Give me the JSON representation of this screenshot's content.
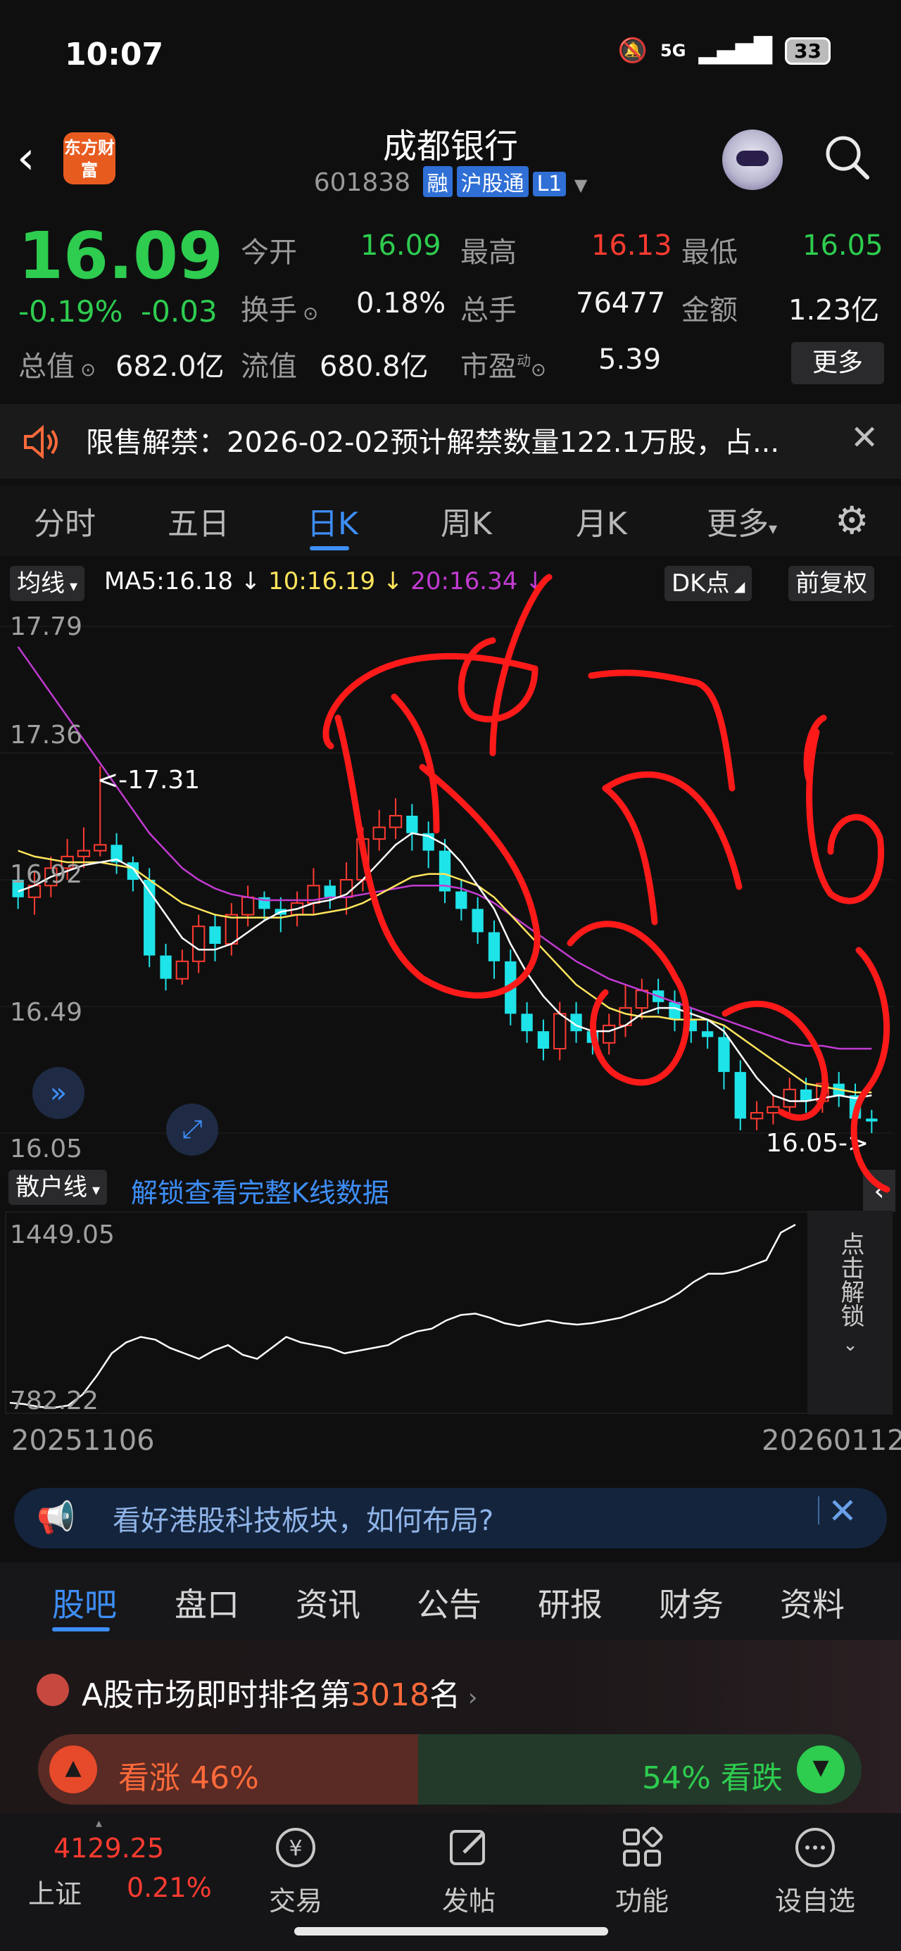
{
  "status_bar": {
    "time": "10:07",
    "network": "5G",
    "battery": "33"
  },
  "header": {
    "logo_text": "东方财富",
    "stock_name": "成都银行",
    "stock_code": "601838",
    "tags": [
      "融",
      "沪股通",
      "L1"
    ]
  },
  "quote": {
    "price": "16.09",
    "change_pct": "-0.19%",
    "change_abs": "-0.03",
    "fields": [
      {
        "label": "今开",
        "value": "16.09",
        "color": "#2ecc4f"
      },
      {
        "label": "最高",
        "value": "16.13",
        "color": "#ff3b30"
      },
      {
        "label": "最低",
        "value": "16.05",
        "color": "#2ecc4f"
      },
      {
        "label": "换手",
        "value": "0.18%",
        "color": "#f2f2f2"
      },
      {
        "label": "总手",
        "value": "76477",
        "color": "#f2f2f2"
      },
      {
        "label": "金额",
        "value": "1.23亿",
        "color": "#f2f2f2"
      },
      {
        "label": "总值",
        "value": "682.0亿",
        "color": "#f2f2f2"
      },
      {
        "label": "流值",
        "value": "680.8亿",
        "color": "#f2f2f2"
      },
      {
        "label": "市盈",
        "value": "5.39",
        "color": "#f2f2f2"
      }
    ],
    "more_label": "更多",
    "pe_superscript": "动"
  },
  "notice": {
    "text": "限售解禁：2026-02-02预计解禁数量122.1万股，占..."
  },
  "period_tabs": [
    "分时",
    "五日",
    "日K",
    "周K",
    "月K",
    "更多"
  ],
  "active_period": "日K",
  "chart_header": {
    "indicator": "均线",
    "ma5": "MA5:16.18 ↓",
    "ma10": "10:16.19 ↓",
    "ma20": "20:16.34 ↓",
    "dk_label": "DK点",
    "adjust_label": "前复权"
  },
  "chart_data": {
    "type": "candlestick",
    "y_ticks": [
      "17.79",
      "17.36",
      "16.92",
      "16.49",
      "16.05"
    ],
    "ylim": [
      16.05,
      17.79
    ],
    "high_annotation": "<-17.31",
    "low_annotation": "16.05->",
    "candles": [
      [
        16.92,
        16.86,
        16.97,
        16.82
      ],
      [
        16.86,
        16.9,
        16.95,
        16.8
      ],
      [
        16.9,
        16.96,
        17.0,
        16.86
      ],
      [
        16.96,
        17.0,
        17.06,
        16.92
      ],
      [
        17.0,
        17.02,
        17.1,
        16.96
      ],
      [
        17.02,
        17.04,
        17.31,
        17.0
      ],
      [
        17.04,
        16.98,
        17.08,
        16.94
      ],
      [
        16.98,
        16.92,
        17.0,
        16.88
      ],
      [
        16.92,
        16.66,
        16.96,
        16.62
      ],
      [
        16.66,
        16.58,
        16.7,
        16.54
      ],
      [
        16.58,
        16.64,
        16.68,
        16.56
      ],
      [
        16.64,
        16.76,
        16.8,
        16.6
      ],
      [
        16.76,
        16.7,
        16.8,
        16.64
      ],
      [
        16.7,
        16.8,
        16.84,
        16.66
      ],
      [
        16.8,
        16.86,
        16.9,
        16.76
      ],
      [
        16.86,
        16.82,
        16.88,
        16.78
      ],
      [
        16.82,
        16.8,
        16.86,
        16.74
      ],
      [
        16.8,
        16.84,
        16.88,
        16.76
      ],
      [
        16.84,
        16.9,
        16.96,
        16.8
      ],
      [
        16.9,
        16.86,
        16.92,
        16.82
      ],
      [
        16.86,
        16.92,
        16.98,
        16.8
      ],
      [
        16.92,
        17.06,
        17.1,
        16.88
      ],
      [
        17.06,
        17.1,
        17.16,
        17.02
      ],
      [
        17.1,
        17.14,
        17.2,
        17.06
      ],
      [
        17.14,
        17.08,
        17.18,
        17.02
      ],
      [
        17.08,
        17.02,
        17.12,
        16.96
      ],
      [
        17.02,
        16.88,
        17.06,
        16.84
      ],
      [
        16.88,
        16.82,
        16.92,
        16.78
      ],
      [
        16.82,
        16.74,
        16.86,
        16.7
      ],
      [
        16.74,
        16.64,
        16.78,
        16.58
      ],
      [
        16.64,
        16.46,
        16.68,
        16.42
      ],
      [
        16.46,
        16.4,
        16.5,
        16.36
      ],
      [
        16.4,
        16.34,
        16.44,
        16.3
      ],
      [
        16.34,
        16.46,
        16.5,
        16.3
      ],
      [
        16.46,
        16.4,
        16.5,
        16.36
      ],
      [
        16.4,
        16.36,
        16.44,
        16.32
      ],
      [
        16.36,
        16.42,
        16.46,
        16.32
      ],
      [
        16.42,
        16.48,
        16.56,
        16.38
      ],
      [
        16.48,
        16.54,
        16.58,
        16.44
      ],
      [
        16.54,
        16.5,
        16.58,
        16.46
      ],
      [
        16.5,
        16.44,
        16.54,
        16.4
      ],
      [
        16.44,
        16.4,
        16.48,
        16.36
      ],
      [
        16.4,
        16.38,
        16.44,
        16.34
      ],
      [
        16.38,
        16.26,
        16.42,
        16.2
      ],
      [
        16.26,
        16.1,
        16.3,
        16.06
      ],
      [
        16.1,
        16.12,
        16.16,
        16.06
      ],
      [
        16.12,
        16.14,
        16.18,
        16.08
      ],
      [
        16.14,
        16.2,
        16.24,
        16.1
      ],
      [
        16.2,
        16.16,
        16.24,
        16.12
      ],
      [
        16.16,
        16.22,
        16.26,
        16.12
      ],
      [
        16.22,
        16.18,
        16.26,
        16.14
      ],
      [
        16.18,
        16.1,
        16.22,
        16.06
      ],
      [
        16.1,
        16.09,
        16.13,
        16.05
      ]
    ],
    "candle_order": [
      "open",
      "close",
      "high",
      "low"
    ],
    "ma5": [
      16.88,
      16.9,
      16.93,
      16.95,
      16.97,
      16.98,
      16.99,
      16.96,
      16.88,
      16.8,
      16.72,
      16.68,
      16.68,
      16.7,
      16.74,
      16.78,
      16.81,
      16.82,
      16.84,
      16.85,
      16.87,
      16.92,
      16.98,
      17.04,
      17.08,
      17.07,
      17.04,
      16.98,
      16.9,
      16.82,
      16.7,
      16.6,
      16.52,
      16.46,
      16.42,
      16.4,
      16.4,
      16.42,
      16.46,
      16.48,
      16.48,
      16.46,
      16.44,
      16.4,
      16.32,
      16.24,
      16.18,
      16.16,
      16.16,
      16.17,
      16.18,
      16.17,
      16.18
    ],
    "ma10": [
      17.02,
      17.0,
      16.99,
      16.98,
      16.98,
      16.98,
      16.97,
      16.96,
      16.92,
      16.88,
      16.84,
      16.82,
      16.8,
      16.79,
      16.79,
      16.79,
      16.79,
      16.8,
      16.8,
      16.81,
      16.82,
      16.84,
      16.87,
      16.9,
      16.93,
      16.94,
      16.94,
      16.92,
      16.9,
      16.86,
      16.8,
      16.74,
      16.68,
      16.62,
      16.56,
      16.52,
      16.48,
      16.46,
      16.45,
      16.45,
      16.44,
      16.44,
      16.44,
      16.42,
      16.38,
      16.34,
      16.3,
      16.26,
      16.22,
      16.21,
      16.2,
      16.19,
      16.19
    ],
    "ma20": [
      17.72,
      17.64,
      17.56,
      17.48,
      17.4,
      17.32,
      17.24,
      17.16,
      17.08,
      17.02,
      16.96,
      16.92,
      16.89,
      16.87,
      16.86,
      16.85,
      16.85,
      16.85,
      16.85,
      16.86,
      16.86,
      16.87,
      16.88,
      16.89,
      16.9,
      16.9,
      16.9,
      16.89,
      16.87,
      16.84,
      16.8,
      16.76,
      16.72,
      16.68,
      16.64,
      16.61,
      16.58,
      16.56,
      16.54,
      16.52,
      16.5,
      16.48,
      16.46,
      16.44,
      16.42,
      16.4,
      16.38,
      16.36,
      16.35,
      16.35,
      16.34,
      16.34,
      16.34
    ],
    "sub_indicator": "散户线",
    "sub_y_ticks": [
      "1449.05",
      "782.22"
    ],
    "sub_values": [
      800,
      795,
      785,
      782,
      790,
      830,
      900,
      980,
      1020,
      1040,
      1030,
      1000,
      980,
      960,
      990,
      1010,
      975,
      960,
      1000,
      1040,
      1020,
      1010,
      1000,
      980,
      990,
      1000,
      1010,
      1040,
      1060,
      1070,
      1100,
      1120,
      1125,
      1110,
      1090,
      1080,
      1090,
      1100,
      1090,
      1085,
      1090,
      1100,
      1110,
      1130,
      1150,
      1170,
      1200,
      1240,
      1270,
      1270,
      1280,
      1300,
      1320,
      1420,
      1449
    ],
    "x_start": "20251106",
    "x_end": "20260112",
    "colors": {
      "up": "#ff3b30",
      "down": "#1ee3e8",
      "ma5": "#ffffff",
      "ma10": "#ffe55c",
      "ma20": "#c23bd1"
    }
  },
  "unlock": {
    "text": "解锁查看完整K线数据",
    "side_text": "点击解锁"
  },
  "ad": {
    "text": "看好港股科技板块，如何布局?"
  },
  "section_tabs": [
    "股吧",
    "盘口",
    "资讯",
    "公告",
    "研报",
    "财务",
    "资料"
  ],
  "rank": {
    "prefix": "A股市场即时排名第",
    "number": "3018",
    "suffix": "名"
  },
  "vote": {
    "up_label": "看涨 46%",
    "down_label": "54% 看跌",
    "up_pct": 46
  },
  "index": {
    "value": "4129.25",
    "name": "上证",
    "change": "0.21%"
  },
  "bottom_nav": [
    {
      "label": "交易",
      "icon": "trade-icon"
    },
    {
      "label": "发帖",
      "icon": "post-icon"
    },
    {
      "label": "功能",
      "icon": "apps-icon"
    },
    {
      "label": "设自选",
      "icon": "favorite-icon"
    }
  ]
}
